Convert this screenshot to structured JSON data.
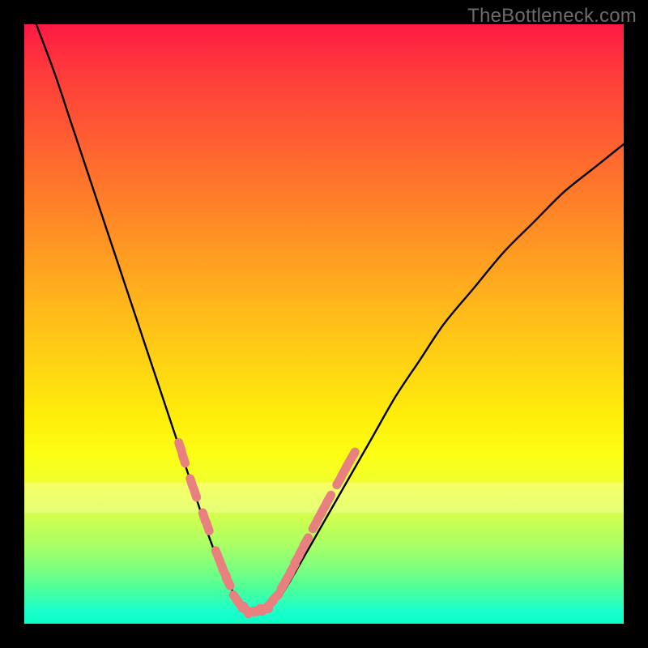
{
  "attribution": "TheBottleneck.com",
  "colors": {
    "background_frame": "#000000",
    "gradient_top": "#ff1a44",
    "gradient_mid": "#ffd712",
    "gradient_bottom": "#0affc3",
    "curve_stroke": "#000000",
    "marker_fill": "#e98080",
    "marker_fill_alt": "#d87272"
  },
  "chart_data": {
    "type": "line",
    "title": "",
    "xlabel": "",
    "ylabel": "",
    "xlim": [
      0,
      100
    ],
    "ylim": [
      0,
      100
    ],
    "grid": false,
    "legend": false,
    "series": [
      {
        "name": "bottleneck-curve",
        "x": [
          2,
          5,
          8,
          11,
          14,
          17,
          20,
          23,
          25,
          27,
          29,
          31,
          33,
          35,
          37,
          38,
          40,
          43,
          46,
          50,
          54,
          58,
          62,
          66,
          70,
          75,
          80,
          85,
          90,
          95,
          100
        ],
        "y": [
          100,
          92,
          83,
          74,
          65,
          56,
          47,
          38,
          32,
          26,
          20,
          14,
          9,
          5,
          2,
          2,
          2,
          5,
          10,
          17,
          24,
          31,
          38,
          44,
          50,
          56,
          62,
          67,
          72,
          76,
          80
        ]
      }
    ],
    "markers": [
      {
        "x": 26.0,
        "y": 29.5
      },
      {
        "x": 26.6,
        "y": 27.5
      },
      {
        "x": 27.9,
        "y": 23.5
      },
      {
        "x": 28.5,
        "y": 21.8
      },
      {
        "x": 30.0,
        "y": 17.8
      },
      {
        "x": 30.6,
        "y": 16.2
      },
      {
        "x": 32.2,
        "y": 11.5
      },
      {
        "x": 32.8,
        "y": 10.0
      },
      {
        "x": 33.4,
        "y": 8.5
      },
      {
        "x": 34.0,
        "y": 7.0
      },
      {
        "x": 35.3,
        "y": 4.2
      },
      {
        "x": 36.0,
        "y": 3.2
      },
      {
        "x": 37.0,
        "y": 2.3
      },
      {
        "x": 38.0,
        "y": 2.0
      },
      {
        "x": 39.0,
        "y": 2.1
      },
      {
        "x": 40.0,
        "y": 2.5
      },
      {
        "x": 41.0,
        "y": 3.3
      },
      {
        "x": 42.0,
        "y": 4.5
      },
      {
        "x": 43.2,
        "y": 6.4
      },
      {
        "x": 44.0,
        "y": 7.8
      },
      {
        "x": 44.8,
        "y": 9.3
      },
      {
        "x": 45.5,
        "y": 10.8
      },
      {
        "x": 46.3,
        "y": 12.3
      },
      {
        "x": 47.0,
        "y": 13.7
      },
      {
        "x": 48.5,
        "y": 16.5
      },
      {
        "x": 49.3,
        "y": 18.0
      },
      {
        "x": 50.0,
        "y": 19.3
      },
      {
        "x": 50.8,
        "y": 20.8
      },
      {
        "x": 52.5,
        "y": 23.8
      },
      {
        "x": 53.3,
        "y": 25.3
      },
      {
        "x": 54.0,
        "y": 26.6
      },
      {
        "x": 54.8,
        "y": 28.0
      }
    ]
  }
}
